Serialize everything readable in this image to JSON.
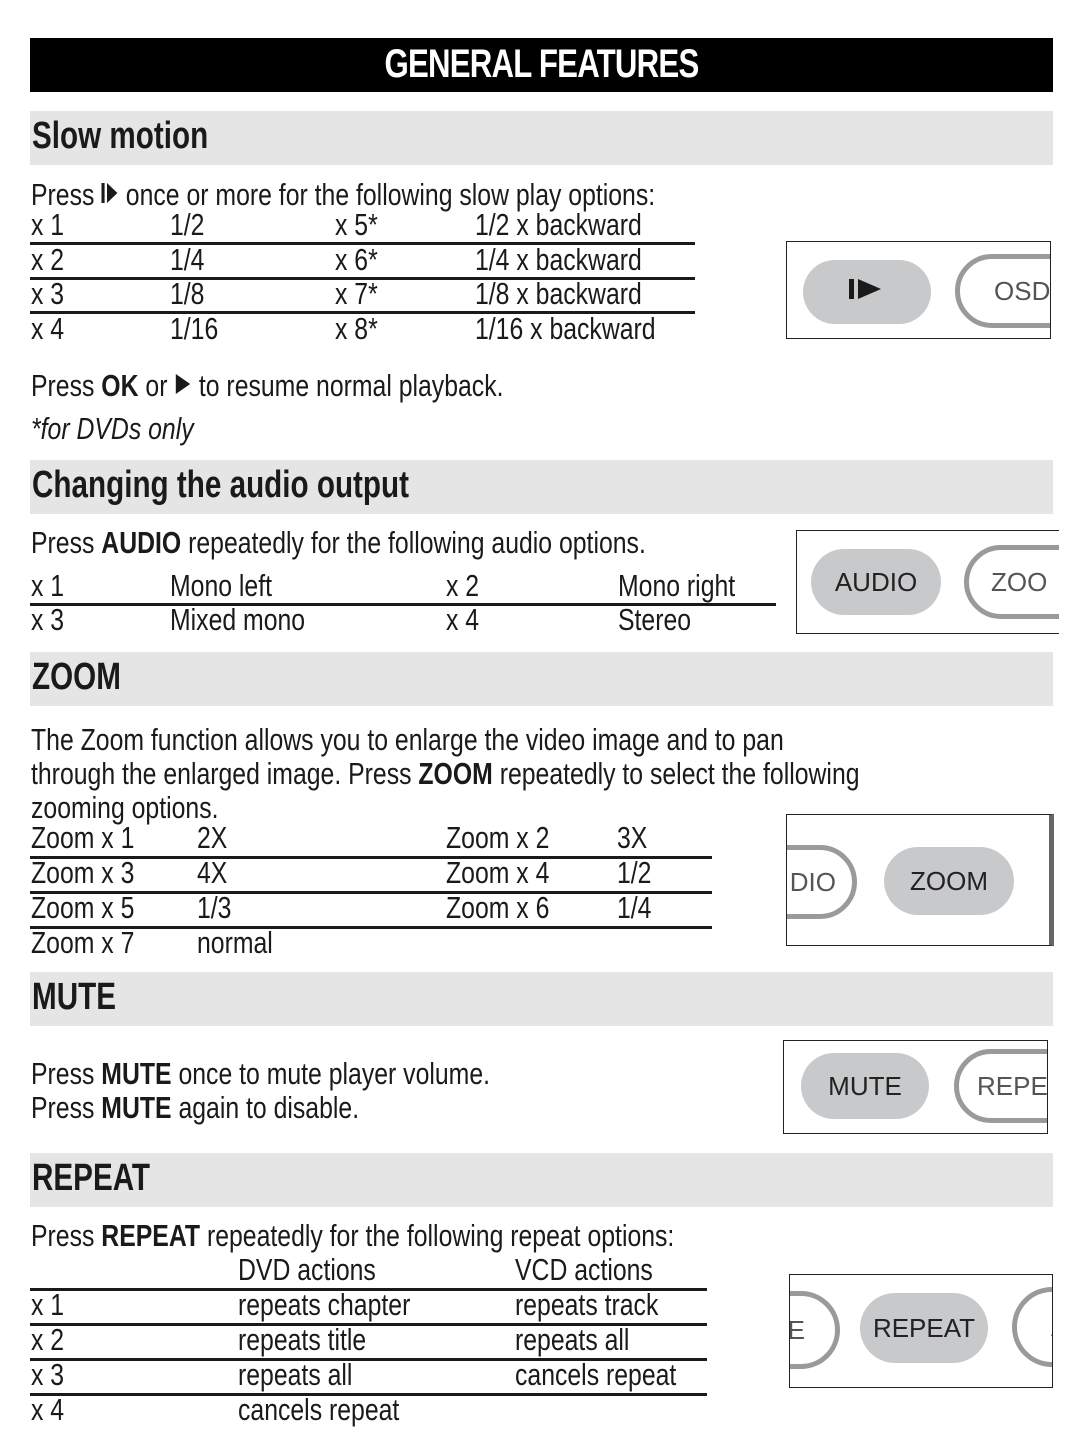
{
  "page_title": "GENERAL FEATURES",
  "slow_motion": {
    "heading": "Slow motion",
    "intro_prefix": "Press",
    "intro_icon": "slow-play-icon",
    "intro_suffix": "once or more for the following slow play options:",
    "rows": [
      {
        "press": "x 1",
        "speed": "1/2",
        "press2": "x 5*",
        "speed2": "1/2 x backward"
      },
      {
        "press": "x 2",
        "speed": "1/4",
        "press2": "x 6*",
        "speed2": "1/4 x backward"
      },
      {
        "press": "x 3",
        "speed": "1/8",
        "press2": "x 7*",
        "speed2": "1/8 x backward"
      },
      {
        "press": "x 4",
        "speed": "1/16",
        "press2": "x 8*",
        "speed2": "1/16 x backward"
      }
    ],
    "resume_prefix": "Press",
    "resume_bold": "OK",
    "resume_mid": "or",
    "resume_icon": "play-icon",
    "resume_suffix": "to resume normal playback.",
    "footnote": "*for DVDs only",
    "remote": {
      "active_button": "slow-play",
      "next_button": "OSD"
    }
  },
  "audio": {
    "heading": "Changing the audio output",
    "intro_prefix": "Press",
    "intro_bold": "AUDIO",
    "intro_suffix": "repeatedly for the following audio options.",
    "rows": [
      {
        "press": "x 1",
        "mode": "Mono left",
        "press2": "x 2",
        "mode2": "Mono right"
      },
      {
        "press": "x 3",
        "mode": "Mixed mono",
        "press2": "x 4",
        "mode2": "Stereo"
      }
    ],
    "remote": {
      "active_button": "AUDIO",
      "next_button": "ZOO"
    }
  },
  "zoom": {
    "heading": "ZOOM",
    "desc_line1": "The Zoom function allows you to enlarge the video image and to pan",
    "desc_line2_prefix": "through the enlarged image.  Press",
    "desc_line2_bold": "ZOOM",
    "desc_line2_suffix": "repeatedly to select the following",
    "desc_line3": "zooming options.",
    "rows": [
      {
        "press": "Zoom x 1",
        "level": "2X",
        "press2": "Zoom x 2",
        "level2": "3X"
      },
      {
        "press": "Zoom x 3",
        "level": "4X",
        "press2": "Zoom x 4",
        "level2": "1/2"
      },
      {
        "press": "Zoom x 5",
        "level": "1/3",
        "press2": "Zoom x 6",
        "level2": "1/4"
      },
      {
        "press": "Zoom x 7",
        "level": "normal",
        "press2": "",
        "level2": ""
      }
    ],
    "remote": {
      "prev_button": "DIO",
      "active_button": "ZOOM"
    }
  },
  "mute": {
    "heading": "MUTE",
    "line1_prefix": "Press",
    "line1_bold": "MUTE",
    "line1_suffix": "once to mute player volume.",
    "line2_prefix": "Press",
    "line2_bold": "MUTE",
    "line2_suffix": "again to disable.",
    "remote": {
      "active_button": "MUTE",
      "next_button": "REPEA"
    }
  },
  "repeat": {
    "heading": "REPEAT",
    "intro_prefix": "Press",
    "intro_bold": "REPEAT",
    "intro_suffix": "repeatedly for the following repeat options:",
    "columns": [
      "",
      "DVD actions",
      "VCD actions"
    ],
    "rows": [
      {
        "press": "x 1",
        "dvd": "repeats chapter",
        "vcd": "repeats track"
      },
      {
        "press": "x 2",
        "dvd": "repeats title",
        "vcd": "repeats all"
      },
      {
        "press": "x 3",
        "dvd": "repeats all",
        "vcd": "cancels repeat"
      },
      {
        "press": "x 4",
        "dvd": "cancels repeat",
        "vcd": ""
      }
    ],
    "remote": {
      "prev_button": "E",
      "active_button": "REPEAT",
      "next_button": "A"
    }
  }
}
